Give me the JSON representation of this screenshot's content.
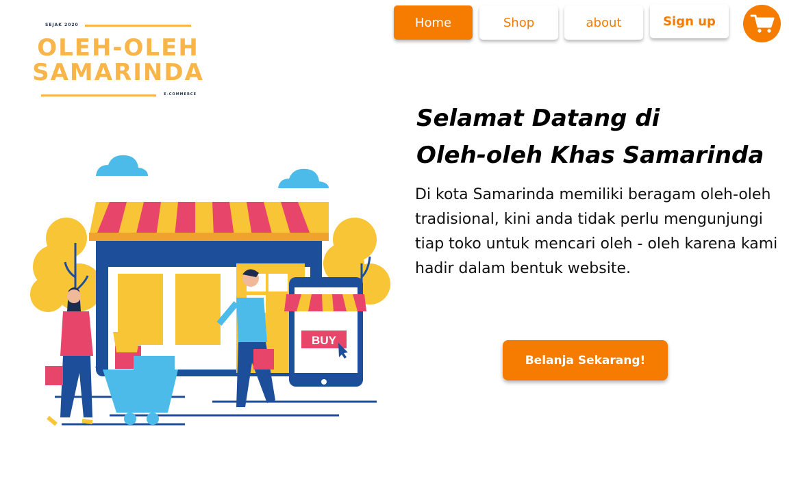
{
  "logo": {
    "top_small": "SEJAK 2020",
    "line1": "OLEH-OLEH",
    "line2": "SAMARINDA",
    "bottom_small": "E-COMMERCE"
  },
  "nav": {
    "home": "Home",
    "shop": "Shop",
    "about": "about",
    "signup": "Sign up",
    "cart_icon": "cart-icon"
  },
  "hero": {
    "title_line1": "Selamat Datang di",
    "title_line2": "Oleh-oleh Khas Samarinda",
    "description": " Di kota Samarinda memiliki beragam oleh-oleh tradisional, kini anda tidak perlu mengunjungi tiap toko untuk mencari oleh - oleh karena kami hadir dalam bentuk website.",
    "cta_label": "Belanja Sekarang!"
  },
  "illustration": {
    "buy_label": "BUY"
  },
  "colors": {
    "accent": "#f57c00",
    "logo": "#f8b54a",
    "navy": "#1d4e9a",
    "pink": "#e8456a",
    "yellow": "#f8c537",
    "sky": "#4dbbea"
  }
}
